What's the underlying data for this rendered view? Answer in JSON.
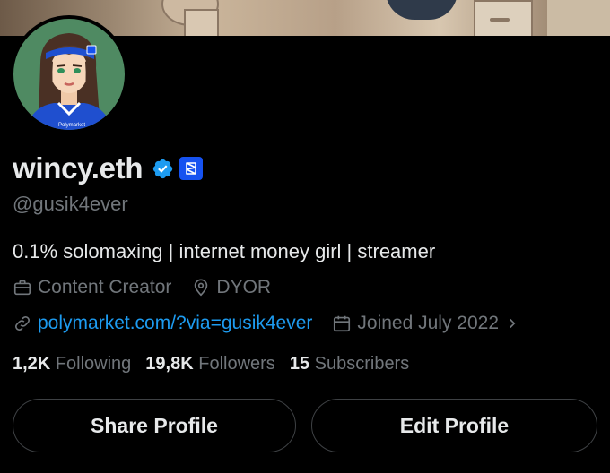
{
  "profile": {
    "display_name": "wincy.eth",
    "handle": "@gusik4ever",
    "bio": "0.1% solomaxing | internet money girl | streamer",
    "avatar_jersey_text": "Polymarket",
    "category": "Content Creator",
    "location": "DYOR",
    "website": "polymarket.com/?via=gusik4ever",
    "joined": "Joined July 2022"
  },
  "stats": {
    "following_count": "1,2K",
    "following_label": "Following",
    "followers_count": "19,8K",
    "followers_label": "Followers",
    "subscribers_count": "15",
    "subscribers_label": "Subscribers"
  },
  "actions": {
    "share_label": "Share Profile",
    "edit_label": "Edit Profile"
  },
  "icons": {
    "verified": "verified-badge-icon",
    "affiliate": "polymarket-affiliate-icon",
    "category": "briefcase-icon",
    "location": "location-pin-icon",
    "website": "link-icon",
    "joined": "calendar-icon",
    "chevron": "chevron-right-icon"
  },
  "colors": {
    "background": "#000000",
    "text_primary": "#e7e9ea",
    "text_secondary": "#71767b",
    "link": "#1d9bf0",
    "verified": "#1d9bf0",
    "affiliate_badge": "#1652f0"
  }
}
